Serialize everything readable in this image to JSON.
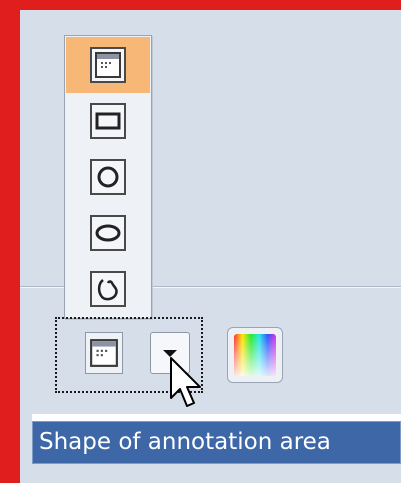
{
  "tooltip": {
    "text": "Shape of annotation area"
  },
  "shape_menu": {
    "selected_index": 0,
    "items": [
      {
        "icon": "area-shape-icon"
      },
      {
        "icon": "rectangle-shape-icon"
      },
      {
        "icon": "circle-shape-icon"
      },
      {
        "icon": "ellipse-shape-icon"
      },
      {
        "icon": "freehand-shape-icon"
      }
    ]
  },
  "colors": {
    "accent_selected": "#f7b877",
    "tooltip_background": "#3d67a6",
    "frame_border": "#e11e1e"
  }
}
